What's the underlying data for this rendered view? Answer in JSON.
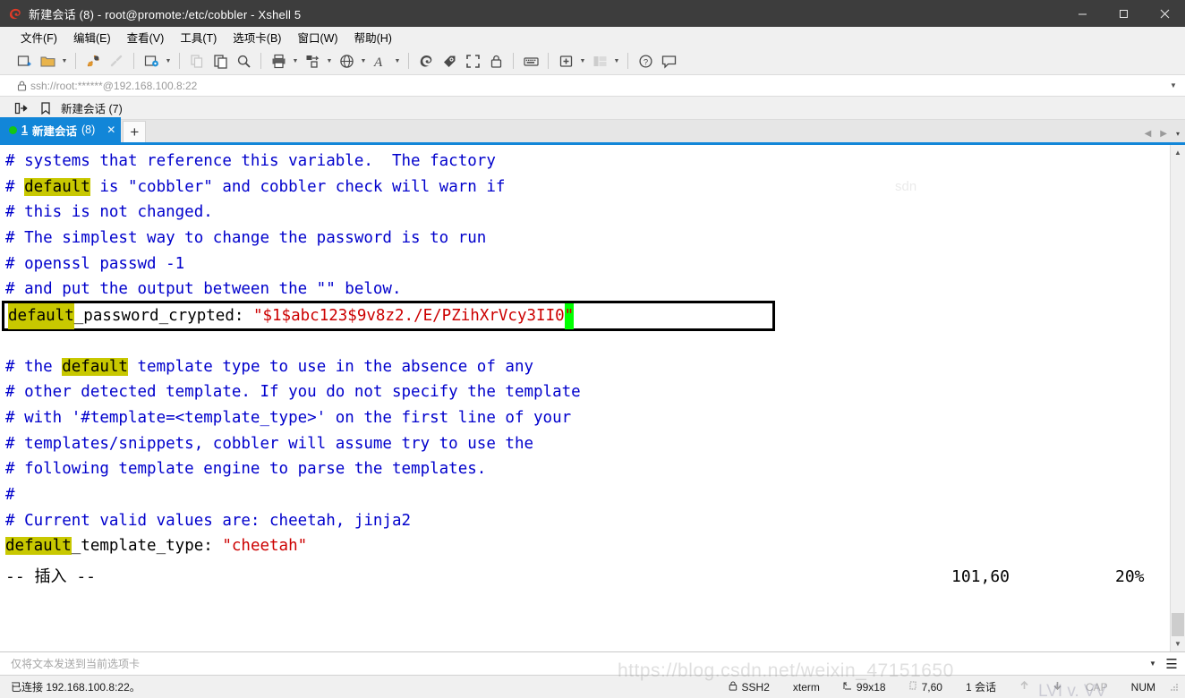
{
  "window": {
    "title": "新建会话 (8) - root@promote:/etc/cobbler - Xshell 5",
    "app_icon": "xshell-logo-icon",
    "minimize": "—",
    "maximize": "□",
    "close": "✕"
  },
  "menubar": {
    "items": [
      {
        "label": "文件(F)",
        "name": "menu-file"
      },
      {
        "label": "编辑(E)",
        "name": "menu-edit"
      },
      {
        "label": "查看(V)",
        "name": "menu-view"
      },
      {
        "label": "工具(T)",
        "name": "menu-tools"
      },
      {
        "label": "选项卡(B)",
        "name": "menu-tabs"
      },
      {
        "label": "窗口(W)",
        "name": "menu-window"
      },
      {
        "label": "帮助(H)",
        "name": "menu-help"
      }
    ]
  },
  "toolbar": {
    "buttons": [
      "new-session-icon",
      "open-folder-icon",
      "connect-icon",
      "disconnect-icon",
      "session-properties-icon",
      "copy-icon",
      "paste-icon",
      "find-icon",
      "print-icon",
      "transfer-icon",
      "browser-icon",
      "font-icon",
      "xftp-icon",
      "xagent-icon",
      "fullscreen-icon",
      "lock-icon",
      "keyboard-icon",
      "add-tab-icon",
      "arrange-icon",
      "help-icon",
      "feedback-icon"
    ]
  },
  "address_bar": {
    "lock_icon": "lock-icon",
    "value": "ssh://root:******@192.168.100.8:22",
    "dropdown_icon": "chevron-down-icon"
  },
  "session_bar": {
    "forward_icon": "open-session-icon",
    "bookmark_icon": "bookmark-icon",
    "label": "新建会话 (7)"
  },
  "tab_bar": {
    "active_tab": {
      "status_icon": "green-dot-icon",
      "index": "1",
      "label": "新建会话",
      "count": "(8)",
      "close_icon": "✕"
    },
    "new_tab_label": "+",
    "prev_icon": "◀",
    "next_icon": "▶",
    "list_icon": "▾"
  },
  "terminal": {
    "lines": [
      {
        "segments": [
          {
            "t": "# systems that reference this variable.  The factory",
            "c": "comment"
          }
        ]
      },
      {
        "segments": [
          {
            "t": "# ",
            "c": "comment"
          },
          {
            "t": "default",
            "c": "hl"
          },
          {
            "t": " is \"cobbler\" and cobbler check will warn if",
            "c": "comment"
          }
        ]
      },
      {
        "segments": [
          {
            "t": "# this is not changed.",
            "c": "comment"
          }
        ]
      },
      {
        "segments": [
          {
            "t": "# The simplest way to change the password is to run",
            "c": "comment"
          }
        ]
      },
      {
        "segments": [
          {
            "t": "# openssl passwd -1",
            "c": "comment"
          }
        ]
      },
      {
        "segments": [
          {
            "t": "# and put the output between the \"\" below.",
            "c": "comment"
          }
        ]
      }
    ],
    "highlighted_line": {
      "segments": [
        {
          "t": "default",
          "c": "hl"
        },
        {
          "t": "_password_crypted: ",
          "c": "black"
        },
        {
          "t": "\"$1$abc123$9v8z2./E/PZihXrVcy3II0",
          "c": "red"
        },
        {
          "t": "\"",
          "c": "cursor"
        }
      ]
    },
    "lines_after": [
      {
        "segments": [
          {
            "t": "",
            "c": "comment"
          }
        ]
      },
      {
        "segments": [
          {
            "t": "# the ",
            "c": "comment"
          },
          {
            "t": "default",
            "c": "hl"
          },
          {
            "t": " template type to use in the absence of any",
            "c": "comment"
          }
        ]
      },
      {
        "segments": [
          {
            "t": "# other detected template. If you do not specify the template",
            "c": "comment"
          }
        ]
      },
      {
        "segments": [
          {
            "t": "# with '#template=<template_type>' on the first line of your",
            "c": "comment"
          }
        ]
      },
      {
        "segments": [
          {
            "t": "# templates/snippets, cobbler will assume try to use the",
            "c": "comment"
          }
        ]
      },
      {
        "segments": [
          {
            "t": "# following template engine to parse the templates.",
            "c": "comment"
          }
        ]
      },
      {
        "segments": [
          {
            "t": "#",
            "c": "comment"
          }
        ]
      },
      {
        "segments": [
          {
            "t": "# Current valid values are: cheetah, jinja2",
            "c": "comment"
          }
        ]
      },
      {
        "segments": [
          {
            "t": "default",
            "c": "hl"
          },
          {
            "t": "_template_type: ",
            "c": "black"
          },
          {
            "t": "\"cheetah\"",
            "c": "red"
          }
        ]
      }
    ],
    "vim_status": {
      "mode": "-- 插入 --",
      "position": "101,60",
      "percent": "20%"
    },
    "colors": {
      "comment": "#0000cc",
      "highlight_bg": "#c8c800",
      "string": "#cc0000",
      "cursor_bg": "#00ff00",
      "background": "#ffffff"
    }
  },
  "send_bar": {
    "placeholder": "仅将文本发送到当前选项卡",
    "dropdown_icon": "chevron-down-icon",
    "menu_icon": "hamburger-icon"
  },
  "status_bar": {
    "connection": "已连接 192.168.100.8:22。",
    "cells": [
      {
        "icon": "lock-icon",
        "label": "SSH2",
        "name": "status-protocol",
        "muted": false
      },
      {
        "icon": "",
        "label": "xterm",
        "name": "status-terminal-type",
        "muted": false
      },
      {
        "icon": "size-icon",
        "label": "99x18",
        "name": "status-size",
        "muted": false
      },
      {
        "icon": "cursor-icon",
        "label": "7,60",
        "name": "status-cursor",
        "muted": false
      },
      {
        "icon": "",
        "label": "1 会话",
        "name": "status-sessions",
        "muted": false
      },
      {
        "icon": "upload-icon",
        "label": "",
        "name": "status-upload",
        "muted": true
      },
      {
        "icon": "download-icon",
        "label": "",
        "name": "status-download",
        "muted": true
      },
      {
        "icon": "",
        "label": "CAP",
        "name": "status-caps-lock",
        "muted": true
      },
      {
        "icon": "",
        "label": "NUM",
        "name": "status-num-lock",
        "muted": false
      }
    ]
  },
  "watermark": {
    "main": "https://blog.csdn.net/weixin_47151650",
    "sub": "LVI v. VV",
    "side": "csdn.net/weixin",
    "top": "sdn"
  }
}
